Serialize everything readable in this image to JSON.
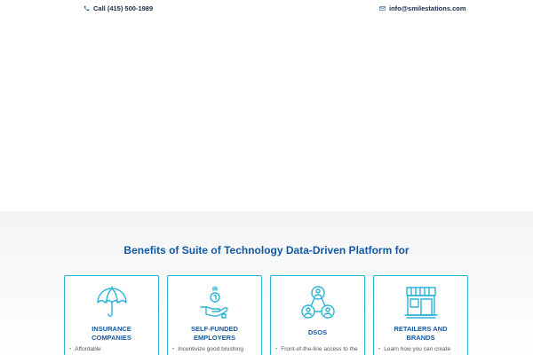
{
  "topbar": {
    "phone": "Call (415) 500-1989",
    "email": "info@smilestations.com"
  },
  "benefits": {
    "title": "Benefits of Suite of Technology Data-Driven Platform for",
    "cards": [
      {
        "title_line1": "INSURANCE",
        "title_line2": "COMPANIES",
        "bullet": "Affordable",
        "icon": "umbrella-icon"
      },
      {
        "title_line1": "SELF-FUNDED",
        "title_line2": "EMPLOYERS",
        "bullet": "Incentivize good brushing",
        "icon": "hand-coin-icon"
      },
      {
        "title_line1": "DSOs",
        "title_line2": "",
        "bullet": "Front-of-the-line access to the",
        "icon": "network-people-icon"
      },
      {
        "title_line1": "RETAILERS AND",
        "title_line2": "BRANDS",
        "bullet": "Learn how you can create",
        "icon": "storefront-icon"
      }
    ]
  },
  "colors": {
    "accent": "#135aa3",
    "icon": "#2bb3d6",
    "section_bg": "#f3f4f5"
  }
}
